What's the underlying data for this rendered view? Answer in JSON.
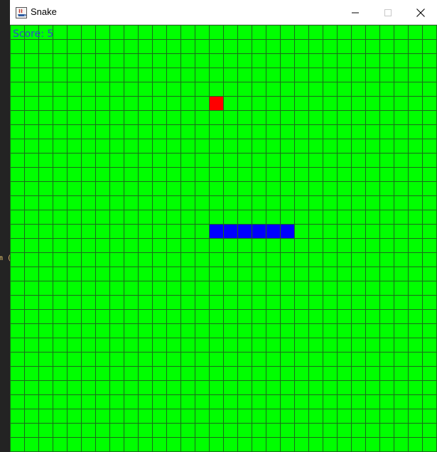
{
  "window": {
    "title": "Snake",
    "icon": "java-app-icon"
  },
  "controls": {
    "minimize": "minimize-icon",
    "maximize": "maximize-icon",
    "close": "close-icon"
  },
  "game": {
    "score_label": "Score: 5",
    "grid": {
      "columns": 30,
      "rows": 30
    },
    "colors": {
      "background": "#00ff00",
      "gridline": "#1a6a1a",
      "food": "#ff0000",
      "snake": "#0000ff",
      "score_text": "#2a4fc8"
    },
    "food": {
      "col": 14,
      "row": 5
    },
    "snake": [
      {
        "col": 14,
        "row": 14
      },
      {
        "col": 15,
        "row": 14
      },
      {
        "col": 16,
        "row": 14
      },
      {
        "col": 17,
        "row": 14
      },
      {
        "col": 18,
        "row": 14
      },
      {
        "col": 19,
        "row": 14
      }
    ]
  },
  "background_window": {
    "partial_text": "m ("
  }
}
